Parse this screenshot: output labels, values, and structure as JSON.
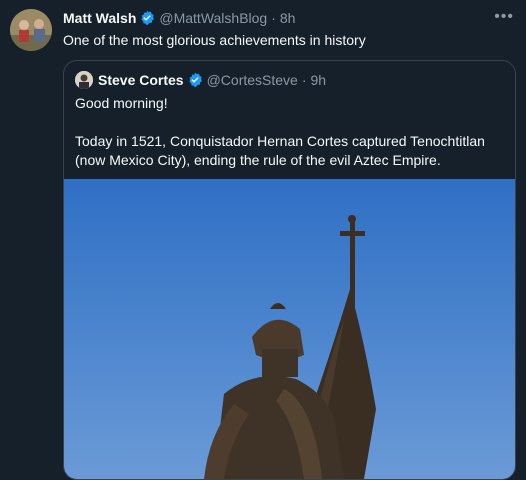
{
  "tweet": {
    "author_name": "Matt Walsh",
    "author_handle": "@MattWalshBlog",
    "time": "8h",
    "text": "One of the most glorious achievements in history"
  },
  "quoted": {
    "author_name": "Steve Cortes",
    "author_handle": "@CortesSteve",
    "time": "9h",
    "paragraph1": "Good morning!",
    "paragraph2": "Today in 1521, Conquistador Hernan Cortes captured Tenochtitlan (now Mexico City), ending the rule of the evil Aztec Empire."
  },
  "icons": {
    "verified": "verified-badge-icon",
    "more": "more-icon"
  },
  "colors": {
    "background": "#15202b",
    "verified": "#1d9bf0",
    "secondary_text": "#8b98a5"
  },
  "separator": "·"
}
